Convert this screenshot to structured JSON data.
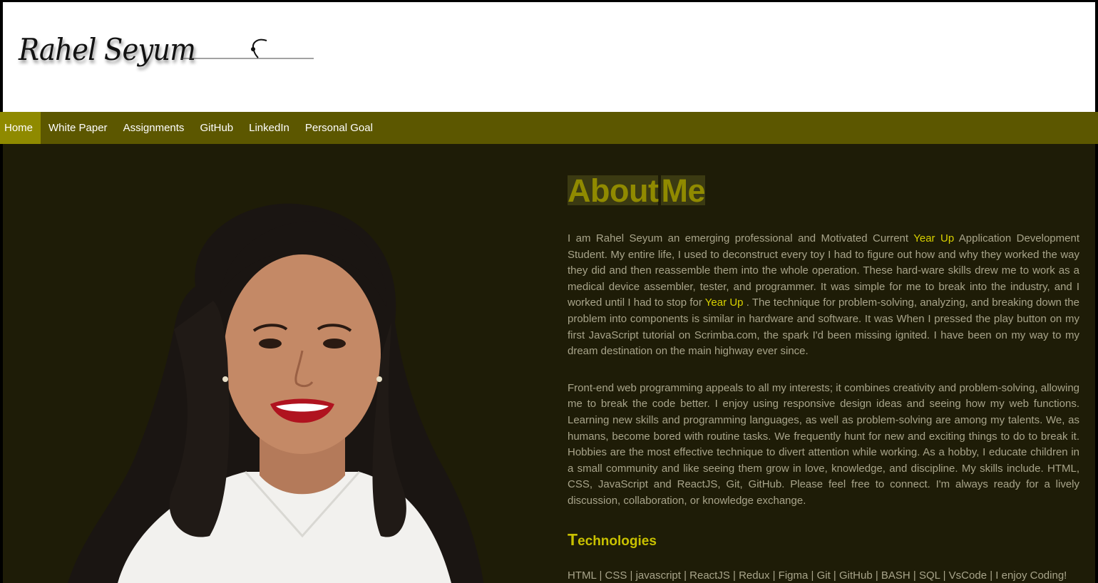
{
  "header": {
    "signature": "Rahel Seyum"
  },
  "nav": {
    "items": [
      {
        "label": "Home",
        "active": true
      },
      {
        "label": "White Paper"
      },
      {
        "label": "Assignments"
      },
      {
        "label": "GitHub"
      },
      {
        "label": "LinkedIn"
      },
      {
        "label": "Personal Goal"
      }
    ]
  },
  "about": {
    "title_word1": "About",
    "title_word2": "Me",
    "p1_a": "I am Rahel Seyum an emerging professional and Motivated Current ",
    "p1_hl1": "Year Up",
    "p1_b": " Application Development Student. My entire life, I used to deconstruct every toy I had to figure out how and why they worked the way they did and then reassemble them into the whole operation. These hard-ware skills drew me to work as a medical device assembler, tester, and programmer. It was simple for me to break into the industry, and I worked until I had to stop for ",
    "p1_hl2": "Year Up",
    "p1_c": " . The technique for problem-solving, analyzing, and breaking down the problem into components is similar in hardware and software. It was When I pressed the play button on my first JavaScript tutorial on Scrimba.com, the spark I'd been missing ignited. I have been on my way to my dream destination on the main highway ever since.",
    "p2": "Front-end web programming appeals to all my interests; it combines creativity and problem-solving, allowing me to break the code better. I enjoy using responsive design ideas and seeing how my web functions. Learning new skills and programming languages, as well as problem-solving are among my talents. We, as humans, become bored with routine tasks. We frequently hunt for new and exciting things to do to break it. Hobbies are the most effective technique to divert attention while working. As a hobby, I educate children in a small community and like seeing them grow in love, knowledge, and discipline. My skills include. HTML, CSS, JavaScript and ReactJS, Git, GitHub. Please feel free to connect. I'm always ready for a lively discussion, collaboration, or knowledge exchange.",
    "tech_heading_first": "T",
    "tech_heading_rest": "echnologies",
    "tech_list": "HTML | CSS | javascript | ReactJS | Redux | Figma | Git | GitHub | BASH | SQL | VsCode | I enjoy Coding!"
  },
  "colors": {
    "nav_bg": "#5c5700",
    "nav_active": "#8f8a00",
    "content_bg": "#1e1c07",
    "accent": "#d8d100",
    "body_text": "#a8a48a"
  }
}
